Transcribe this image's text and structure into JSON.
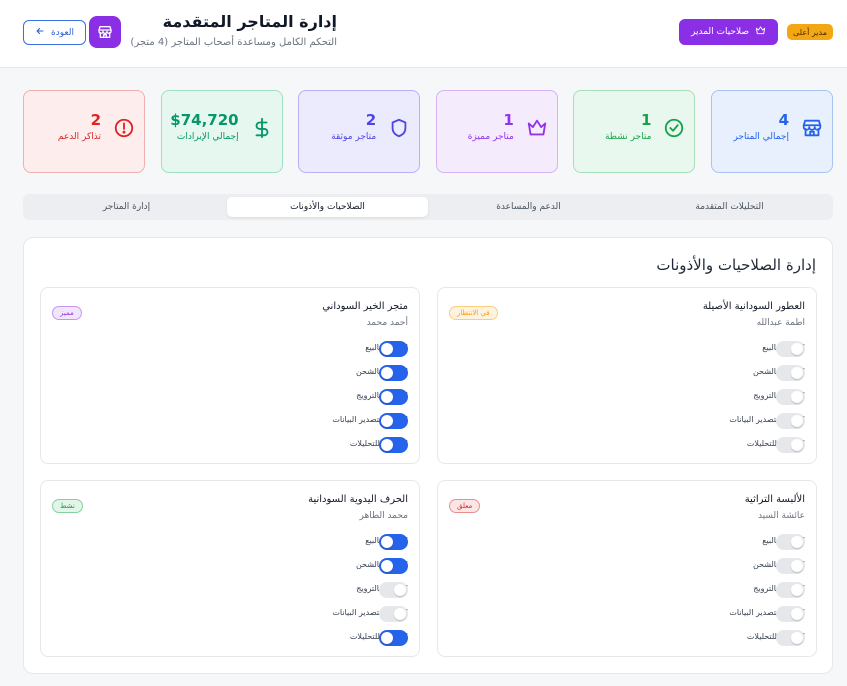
{
  "header": {
    "title": "إدارة المتاجر المتقدمة",
    "subtitle": "التحكم الكامل ومساعدة أصحاب المتاجر (4 متجر)",
    "back_label": "العودة",
    "admin_perms_label": "صلاحيات المدير",
    "role_badge": "مدير أعلى"
  },
  "stats": [
    {
      "value": "4",
      "label": "إجمالي المتاجر",
      "icon": "store-icon",
      "color": "#2563eb"
    },
    {
      "value": "1",
      "label": "متاجر نشطة",
      "icon": "check-circle-icon",
      "color": "#16a34a"
    },
    {
      "value": "1",
      "label": "متاجر مميزة",
      "icon": "crown-icon",
      "color": "#9333ea"
    },
    {
      "value": "2",
      "label": "متاجر موثقة",
      "icon": "shield-icon",
      "color": "#4f46e5"
    },
    {
      "value": "$74,720",
      "label": "إجمالي الإيرادات",
      "icon": "dollar-icon",
      "color": "#059669"
    },
    {
      "value": "2",
      "label": "تذاكر الدعم",
      "icon": "alert-circle-icon",
      "color": "#dc2626"
    }
  ],
  "tabs": [
    {
      "label": "التحليلات المتقدمة",
      "active": false
    },
    {
      "label": "الدعم والمساعدة",
      "active": false
    },
    {
      "label": "الصلاحيات والأذونات",
      "active": true
    },
    {
      "label": "إدارة المتاجر",
      "active": false
    }
  ],
  "panel": {
    "title": "إدارة الصلاحيات والأذونات",
    "stores": [
      {
        "name": "العطور السودانية الأصيلة",
        "owner": "اطمة عبدالله",
        "status": "في الانتظار",
        "status_color": "#f59e0b",
        "permissions": [
          {
            "label": "السماح بالبيع",
            "enabled": false
          },
          {
            "label": "السماح بالشحن",
            "enabled": false
          },
          {
            "label": "السماح بالترويج",
            "enabled": false
          },
          {
            "label": "السماح بتصدير البيانات",
            "enabled": false
          },
          {
            "label": "الوصول للتحليلات",
            "enabled": false
          }
        ]
      },
      {
        "name": "متجر الخير السوداني",
        "owner": "أحمد محمد",
        "status": "مميز",
        "status_color": "#9333ea",
        "permissions": [
          {
            "label": "السماح بالبيع",
            "enabled": true
          },
          {
            "label": "السماح بالشحن",
            "enabled": true
          },
          {
            "label": "السماح بالترويج",
            "enabled": true
          },
          {
            "label": "السماح بتصدير البيانات",
            "enabled": true
          },
          {
            "label": "الوصول للتحليلات",
            "enabled": true
          }
        ]
      },
      {
        "name": "الألبسة التراثية",
        "owner": "عائشة السيد",
        "status": "معلق",
        "status_color": "#dc2626",
        "permissions": [
          {
            "label": "السماح بالبيع",
            "enabled": false
          },
          {
            "label": "السماح بالشحن",
            "enabled": false
          },
          {
            "label": "السماح بالترويج",
            "enabled": false
          },
          {
            "label": "السماح بتصدير البيانات",
            "enabled": false
          },
          {
            "label": "الوصول للتحليلات",
            "enabled": false
          }
        ]
      },
      {
        "name": "الحرف اليدوية السودانية",
        "owner": "محمد الطاهر",
        "status": "نشط",
        "status_color": "#16a34a",
        "permissions": [
          {
            "label": "السماح بالبيع",
            "enabled": true
          },
          {
            "label": "السماح بالشحن",
            "enabled": true
          },
          {
            "label": "السماح بالترويج",
            "enabled": false
          },
          {
            "label": "السماح بتصدير البيانات",
            "enabled": false
          },
          {
            "label": "الوصول للتحليلات",
            "enabled": true
          }
        ]
      }
    ]
  }
}
